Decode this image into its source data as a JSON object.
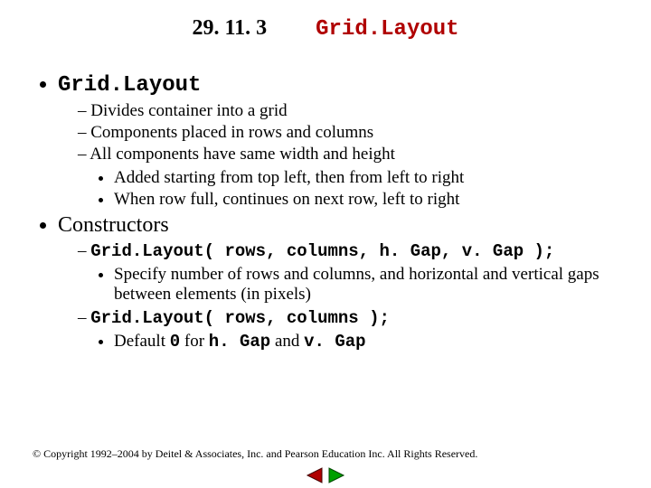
{
  "title": {
    "num": "29. 11. 3",
    "name": "Grid.Layout"
  },
  "b1": {
    "head": "Grid.Layout",
    "subs": [
      "Divides container into a grid",
      "Components placed in rows and columns",
      "All components have same width and height"
    ],
    "subsubs": [
      "Added starting from top left, then from left to right",
      "When row full, continues on next row, left to right"
    ]
  },
  "b2": {
    "head": "Constructors",
    "c1": {
      "sig": "Grid.Layout( rows, columns, h. Gap, v. Gap );",
      "desc": "Specify number of rows and columns, and horizontal and vertical gaps between elements (in pixels)"
    },
    "c2": {
      "sig": "Grid.Layout( rows, columns );",
      "d_pre": "Default ",
      "d_zero": "0",
      "d_mid": " for ",
      "d_h": "h. Gap",
      "d_and": " and ",
      "d_v": "v. Gap"
    }
  },
  "copyright": "© Copyright 1992–2004 by Deitel & Associates, Inc. and Pearson Education Inc. All Rights Reserved."
}
